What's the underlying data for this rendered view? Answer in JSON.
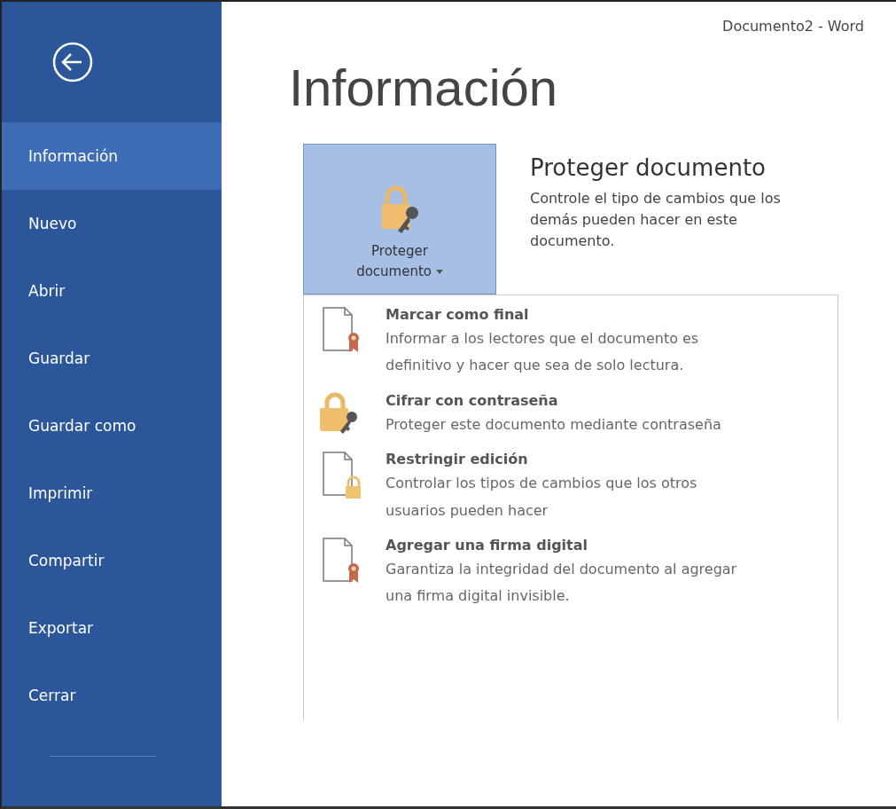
{
  "window": {
    "title": "Documento2 - Word"
  },
  "sidebar": {
    "items": [
      {
        "label": "Información",
        "selected": true
      },
      {
        "label": "Nuevo",
        "selected": false
      },
      {
        "label": "Abrir",
        "selected": false
      },
      {
        "label": "Guardar",
        "selected": false
      },
      {
        "label": "Guardar como",
        "selected": false
      },
      {
        "label": "Imprimir",
        "selected": false
      },
      {
        "label": "Compartir",
        "selected": false
      },
      {
        "label": "Exportar",
        "selected": false
      },
      {
        "label": "Cerrar",
        "selected": false
      }
    ]
  },
  "page": {
    "heading": "Información"
  },
  "protect": {
    "button_label": "Proteger documento",
    "title": "Proteger documento",
    "description": "Controle el tipo de cambios que los demás pueden hacer en este documento."
  },
  "menu": {
    "items": [
      {
        "kind": "ribbon",
        "title": "Marcar como final",
        "description": "Informar a los lectores que el documento es definitivo y hacer que sea de solo lectura."
      },
      {
        "kind": "lock-key",
        "title": "Cifrar con contraseña",
        "description": "Proteger este documento mediante contraseña"
      },
      {
        "kind": "lock",
        "title": "Restringir edición",
        "description": "Controlar los tipos de cambios que los otros usuarios pueden hacer"
      },
      {
        "kind": "ribbon",
        "title": "Agregar una firma digital",
        "description": "Garantiza la integridad del documento al agregar una firma digital invisible."
      }
    ]
  }
}
